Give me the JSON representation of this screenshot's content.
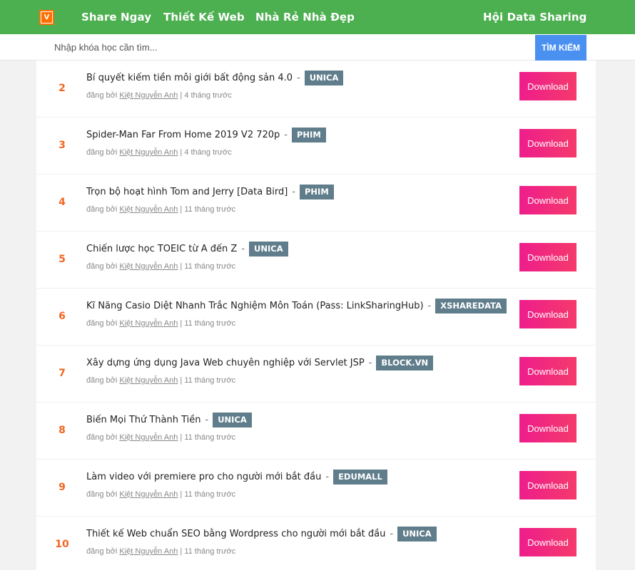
{
  "navbar": {
    "logo_letter": "V",
    "links": [
      "Share Ngay",
      "Thiết Kế Web",
      "Nhà Rẻ Nhà Đẹp"
    ],
    "right_link": "Hội Data Sharing"
  },
  "search": {
    "placeholder": "Nhập khóa học cần tìm...",
    "button_label": "TÌM KIẾM"
  },
  "meta_labels": {
    "posted_by": "đăng bởi",
    "separator": "|",
    "title_separator": "-"
  },
  "download_label": "Download",
  "colors": {
    "navbar": "#4caf50",
    "rank": "#f26522",
    "tag": "#607d8b",
    "download_start": "#ee1d8c",
    "download_end": "#f53a6b",
    "search_button": "#4a90f0"
  },
  "items": [
    {
      "rank": "2",
      "title": "Bí quyết kiếm tiền môi giới bất động sản 4.0",
      "tag": "UNICA",
      "author": "Kiệt Nguyễn Anh",
      "time": "4 tháng trước"
    },
    {
      "rank": "3",
      "title": "Spider-Man Far From Home 2019 V2 720p",
      "tag": "PHIM",
      "author": "Kiệt Nguyễn Anh",
      "time": "4 tháng trước"
    },
    {
      "rank": "4",
      "title": "Trọn bộ hoạt hình Tom and Jerry [Data Bird]",
      "tag": "PHIM",
      "author": "Kiệt Nguyễn Anh",
      "time": "11 tháng trước"
    },
    {
      "rank": "5",
      "title": "Chiến lược học TOEIC từ A đến Z",
      "tag": "UNICA",
      "author": "Kiệt Nguyễn Anh",
      "time": "11 tháng trước"
    },
    {
      "rank": "6",
      "title": "Kĩ Năng Casio Diệt Nhanh Trắc Nghiệm Môn Toán (Pass: LinkSharingHub)",
      "tag": "XSHAREDATA",
      "author": "Kiệt Nguyễn Anh",
      "time": "11 tháng trước"
    },
    {
      "rank": "7",
      "title": "Xây dựng ứng dụng Java Web chuyên nghiệp với Servlet JSP",
      "tag": "BLOCK.VN",
      "author": "Kiệt Nguyễn Anh",
      "time": "11 tháng trước"
    },
    {
      "rank": "8",
      "title": "Biến Mọi Thứ Thành Tiền",
      "tag": "UNICA",
      "author": "Kiệt Nguyễn Anh",
      "time": "11 tháng trước"
    },
    {
      "rank": "9",
      "title": "Làm video với premiere pro cho người mới bắt đầu",
      "tag": "EDUMALL",
      "author": "Kiệt Nguyễn Anh",
      "time": "11 tháng trước"
    },
    {
      "rank": "10",
      "title": "Thiết kế Web chuẩn SEO bằng Wordpress cho người mới bắt đầu",
      "tag": "UNICA",
      "author": "Kiệt Nguyễn Anh",
      "time": "11 tháng trước"
    }
  ]
}
